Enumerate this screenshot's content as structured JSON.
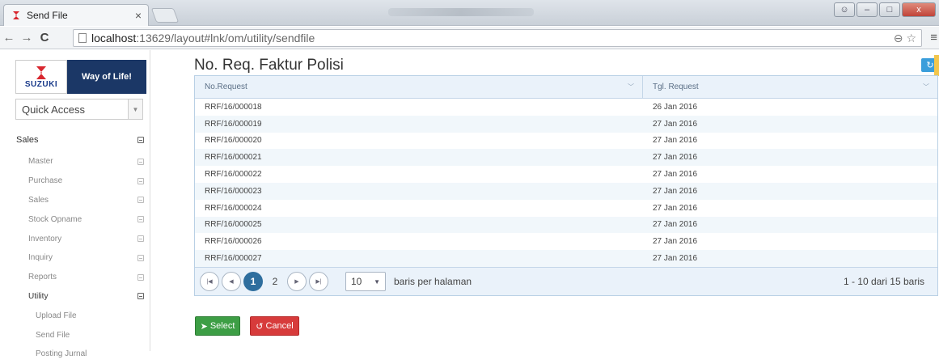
{
  "browser": {
    "tab_title": "Send File",
    "tab_close": "×",
    "url_host": "localhost",
    "url_path": ":13629/layout#lnk/om/utility/sendfile",
    "back": "←",
    "forward": "→",
    "reload": "C",
    "zoom_icon": "⊖",
    "star_icon": "☆",
    "menu_icon": "≡",
    "win_min": "–",
    "win_max": "□",
    "win_close": "x"
  },
  "sidebar": {
    "logo_brand": "SUZUKI",
    "logo_tagline": "Way of Life!",
    "quick_access": "Quick Access",
    "menu": [
      {
        "label": "Sales",
        "level": "top"
      },
      {
        "label": "Master",
        "level": "l1"
      },
      {
        "label": "Purchase",
        "level": "l1"
      },
      {
        "label": "Sales",
        "level": "l1"
      },
      {
        "label": "Stock Opname",
        "level": "l1"
      },
      {
        "label": "Inventory",
        "level": "l1"
      },
      {
        "label": "Inquiry",
        "level": "l1"
      },
      {
        "label": "Reports",
        "level": "l1"
      },
      {
        "label": "Utility",
        "level": "l1 active"
      },
      {
        "label": "Upload File",
        "level": "l2"
      },
      {
        "label": "Send File",
        "level": "l2"
      },
      {
        "label": "Posting Jurnal",
        "level": "l2"
      }
    ]
  },
  "main": {
    "title": "No. Req. Faktur Polisi",
    "grid": {
      "columns": [
        "No.Request",
        "Tgl. Request"
      ],
      "rows": [
        [
          "RRF/16/000018",
          "26 Jan 2016"
        ],
        [
          "RRF/16/000019",
          "27 Jan 2016"
        ],
        [
          "RRF/16/000020",
          "27 Jan 2016"
        ],
        [
          "RRF/16/000021",
          "27 Jan 2016"
        ],
        [
          "RRF/16/000022",
          "27 Jan 2016"
        ],
        [
          "RRF/16/000023",
          "27 Jan 2016"
        ],
        [
          "RRF/16/000024",
          "27 Jan 2016"
        ],
        [
          "RRF/16/000025",
          "27 Jan 2016"
        ],
        [
          "RRF/16/000026",
          "27 Jan 2016"
        ],
        [
          "RRF/16/000027",
          "27 Jan 2016"
        ]
      ]
    },
    "pager": {
      "pages": [
        "1",
        "2"
      ],
      "current": "1",
      "page_size": "10",
      "per_page_label": "baris per halaman",
      "info": "1 - 10 dari 15 baris"
    },
    "buttons": {
      "select": "Select",
      "cancel": "Cancel"
    }
  },
  "colors": {
    "select_button": "#3d9e45",
    "cancel_button": "#d73b3b",
    "current_page": "#2e6e9e",
    "logo_panel": "#1b3766"
  }
}
